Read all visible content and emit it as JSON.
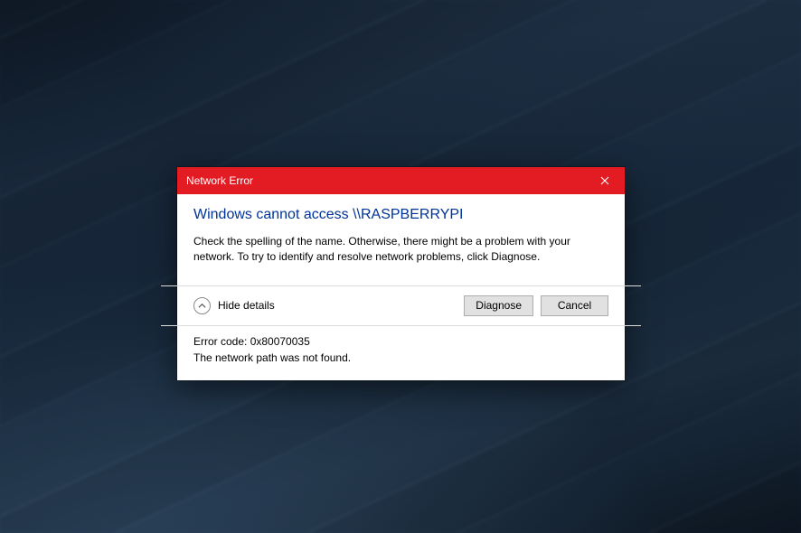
{
  "dialog": {
    "title": "Network Error",
    "headline": "Windows cannot access \\\\RASPBERRYPI",
    "message": "Check the spelling of the name. Otherwise, there might be a problem with your network. To try to identify and resolve network problems, click Diagnose.",
    "toggle_label": "Hide details",
    "buttons": {
      "diagnose": "Diagnose",
      "cancel": "Cancel"
    },
    "details": {
      "error_code_line": "Error code: 0x80070035",
      "error_desc": "The network path was not found."
    }
  }
}
